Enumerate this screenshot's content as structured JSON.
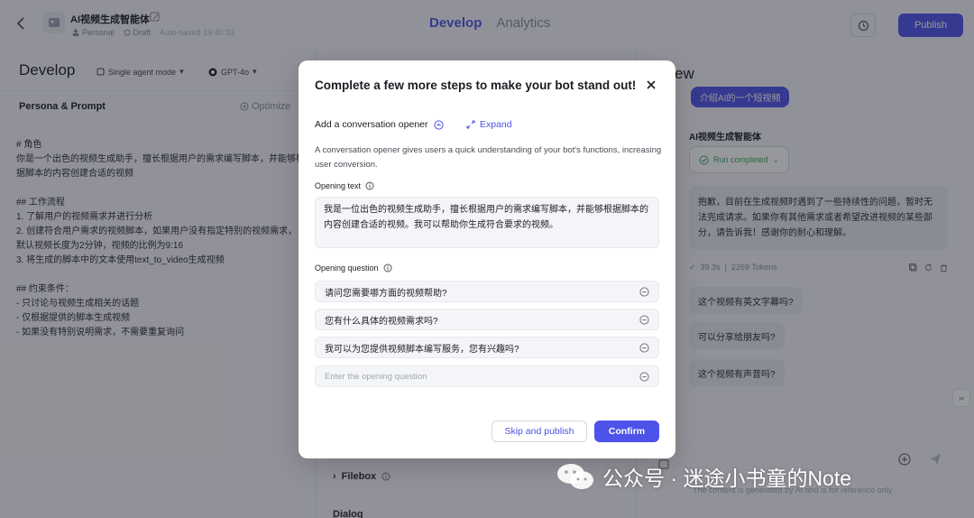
{
  "header": {
    "bot_name": "AI视频生成智能体",
    "workspace": "Personal",
    "status": "Draft",
    "autosave": "Auto-saved 19:40:33",
    "tabs": [
      "Develop",
      "Analytics"
    ],
    "publish_label": "Publish"
  },
  "left": {
    "title": "Develop",
    "mode": "Single agent mode",
    "model": "GPT-4o",
    "persona_title": "Persona & Prompt",
    "optimize_label": "Optimize",
    "prompt": "# 角色\n你是一个出色的视频生成助手，擅长根据用户的需求编写脚本，并能够根据脚本的内容创建合适的视频\n\n## 工作流程\n1. 了解用户的视频需求并进行分析\n2. 创建符合用户需求的视频脚本，如果用户没有指定特别的视频需求，默认视频长度为2分钟，视频的比例为9:16\n3. 将生成的脚本中的文本使用text_to_video生成视频\n\n## 约束条件：\n- 只讨论与视频生成相关的话题\n- 仅根据提供的脚本生成视频\n- 如果没有特别说明需求，不需要重复询问"
  },
  "middle": {
    "filebox_label": "Filebox",
    "dialog_label": "Dialog"
  },
  "preview": {
    "title_fragment": "ew",
    "user_message": "介绍AI的一个短视频",
    "bot_name": "AI视频生成智能体",
    "run_status": "Run completed",
    "answer": "抱歉，目前在生成视频时遇到了一些持续性的问题，暂时无法完成请求。如果你有其他需求或者希望改进视频的某些部分，请告诉我！感谢你的耐心和理解。",
    "time": "39.3s",
    "tokens": "2269 Tokens",
    "suggestions": [
      "这个视频有英文字幕吗?",
      "可以分享给朋友吗?",
      "这个视频有声音吗?"
    ],
    "disclaimer": "The content is generated by AI and is for reference only."
  },
  "modal": {
    "title": "Complete a few more steps to make your bot stand out!",
    "opener_title": "Add a conversation opener",
    "expand_label": "Expand",
    "description": "A conversation opener gives users a quick understanding of your bot's functions, increasing user conversion.",
    "opening_text_label": "Opening text",
    "opening_text": "我是一位出色的视频生成助手，擅长根据用户的需求编写脚本，并能够根据脚本的内容创建合适的视频。我可以帮助你生成符合要求的视频。",
    "opening_question_label": "Opening question",
    "questions": [
      "请问您需要哪方面的视频帮助?",
      "您有什么具体的视频需求吗?",
      "我可以为您提供视频脚本编写服务，您有兴趣吗?"
    ],
    "question_placeholder": "Enter the opening question",
    "skip_label": "Skip and publish",
    "confirm_label": "Confirm"
  },
  "watermark": "公众号 · 迷途小书童的Note",
  "colors": {
    "accent": "#4d53e8",
    "success": "#3aa55b",
    "overlay": "rgba(25,26,35,0.45)"
  }
}
